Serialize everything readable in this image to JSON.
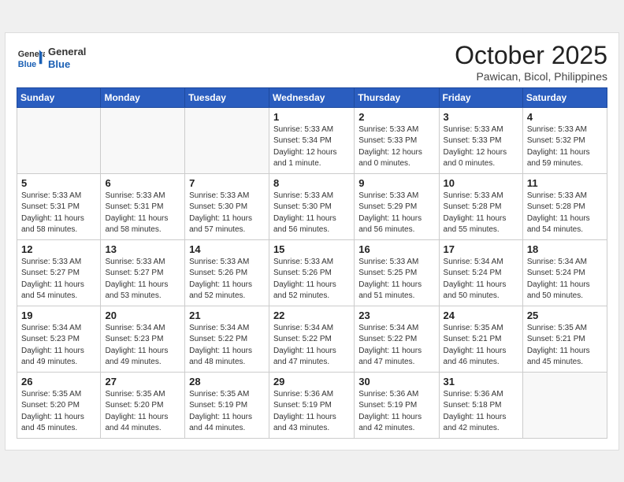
{
  "header": {
    "logo": {
      "text_general": "General",
      "text_blue": "Blue"
    },
    "month": "October 2025",
    "location": "Pawican, Bicol, Philippines"
  },
  "weekdays": [
    "Sunday",
    "Monday",
    "Tuesday",
    "Wednesday",
    "Thursday",
    "Friday",
    "Saturday"
  ],
  "weeks": [
    [
      {
        "day": "",
        "info": ""
      },
      {
        "day": "",
        "info": ""
      },
      {
        "day": "",
        "info": ""
      },
      {
        "day": "1",
        "info": "Sunrise: 5:33 AM\nSunset: 5:34 PM\nDaylight: 12 hours\nand 1 minute."
      },
      {
        "day": "2",
        "info": "Sunrise: 5:33 AM\nSunset: 5:33 PM\nDaylight: 12 hours\nand 0 minutes."
      },
      {
        "day": "3",
        "info": "Sunrise: 5:33 AM\nSunset: 5:33 PM\nDaylight: 12 hours\nand 0 minutes."
      },
      {
        "day": "4",
        "info": "Sunrise: 5:33 AM\nSunset: 5:32 PM\nDaylight: 11 hours\nand 59 minutes."
      }
    ],
    [
      {
        "day": "5",
        "info": "Sunrise: 5:33 AM\nSunset: 5:31 PM\nDaylight: 11 hours\nand 58 minutes."
      },
      {
        "day": "6",
        "info": "Sunrise: 5:33 AM\nSunset: 5:31 PM\nDaylight: 11 hours\nand 58 minutes."
      },
      {
        "day": "7",
        "info": "Sunrise: 5:33 AM\nSunset: 5:30 PM\nDaylight: 11 hours\nand 57 minutes."
      },
      {
        "day": "8",
        "info": "Sunrise: 5:33 AM\nSunset: 5:30 PM\nDaylight: 11 hours\nand 56 minutes."
      },
      {
        "day": "9",
        "info": "Sunrise: 5:33 AM\nSunset: 5:29 PM\nDaylight: 11 hours\nand 56 minutes."
      },
      {
        "day": "10",
        "info": "Sunrise: 5:33 AM\nSunset: 5:28 PM\nDaylight: 11 hours\nand 55 minutes."
      },
      {
        "day": "11",
        "info": "Sunrise: 5:33 AM\nSunset: 5:28 PM\nDaylight: 11 hours\nand 54 minutes."
      }
    ],
    [
      {
        "day": "12",
        "info": "Sunrise: 5:33 AM\nSunset: 5:27 PM\nDaylight: 11 hours\nand 54 minutes."
      },
      {
        "day": "13",
        "info": "Sunrise: 5:33 AM\nSunset: 5:27 PM\nDaylight: 11 hours\nand 53 minutes."
      },
      {
        "day": "14",
        "info": "Sunrise: 5:33 AM\nSunset: 5:26 PM\nDaylight: 11 hours\nand 52 minutes."
      },
      {
        "day": "15",
        "info": "Sunrise: 5:33 AM\nSunset: 5:26 PM\nDaylight: 11 hours\nand 52 minutes."
      },
      {
        "day": "16",
        "info": "Sunrise: 5:33 AM\nSunset: 5:25 PM\nDaylight: 11 hours\nand 51 minutes."
      },
      {
        "day": "17",
        "info": "Sunrise: 5:34 AM\nSunset: 5:24 PM\nDaylight: 11 hours\nand 50 minutes."
      },
      {
        "day": "18",
        "info": "Sunrise: 5:34 AM\nSunset: 5:24 PM\nDaylight: 11 hours\nand 50 minutes."
      }
    ],
    [
      {
        "day": "19",
        "info": "Sunrise: 5:34 AM\nSunset: 5:23 PM\nDaylight: 11 hours\nand 49 minutes."
      },
      {
        "day": "20",
        "info": "Sunrise: 5:34 AM\nSunset: 5:23 PM\nDaylight: 11 hours\nand 49 minutes."
      },
      {
        "day": "21",
        "info": "Sunrise: 5:34 AM\nSunset: 5:22 PM\nDaylight: 11 hours\nand 48 minutes."
      },
      {
        "day": "22",
        "info": "Sunrise: 5:34 AM\nSunset: 5:22 PM\nDaylight: 11 hours\nand 47 minutes."
      },
      {
        "day": "23",
        "info": "Sunrise: 5:34 AM\nSunset: 5:22 PM\nDaylight: 11 hours\nand 47 minutes."
      },
      {
        "day": "24",
        "info": "Sunrise: 5:35 AM\nSunset: 5:21 PM\nDaylight: 11 hours\nand 46 minutes."
      },
      {
        "day": "25",
        "info": "Sunrise: 5:35 AM\nSunset: 5:21 PM\nDaylight: 11 hours\nand 45 minutes."
      }
    ],
    [
      {
        "day": "26",
        "info": "Sunrise: 5:35 AM\nSunset: 5:20 PM\nDaylight: 11 hours\nand 45 minutes."
      },
      {
        "day": "27",
        "info": "Sunrise: 5:35 AM\nSunset: 5:20 PM\nDaylight: 11 hours\nand 44 minutes."
      },
      {
        "day": "28",
        "info": "Sunrise: 5:35 AM\nSunset: 5:19 PM\nDaylight: 11 hours\nand 44 minutes."
      },
      {
        "day": "29",
        "info": "Sunrise: 5:36 AM\nSunset: 5:19 PM\nDaylight: 11 hours\nand 43 minutes."
      },
      {
        "day": "30",
        "info": "Sunrise: 5:36 AM\nSunset: 5:19 PM\nDaylight: 11 hours\nand 42 minutes."
      },
      {
        "day": "31",
        "info": "Sunrise: 5:36 AM\nSunset: 5:18 PM\nDaylight: 11 hours\nand 42 minutes."
      },
      {
        "day": "",
        "info": ""
      }
    ]
  ]
}
